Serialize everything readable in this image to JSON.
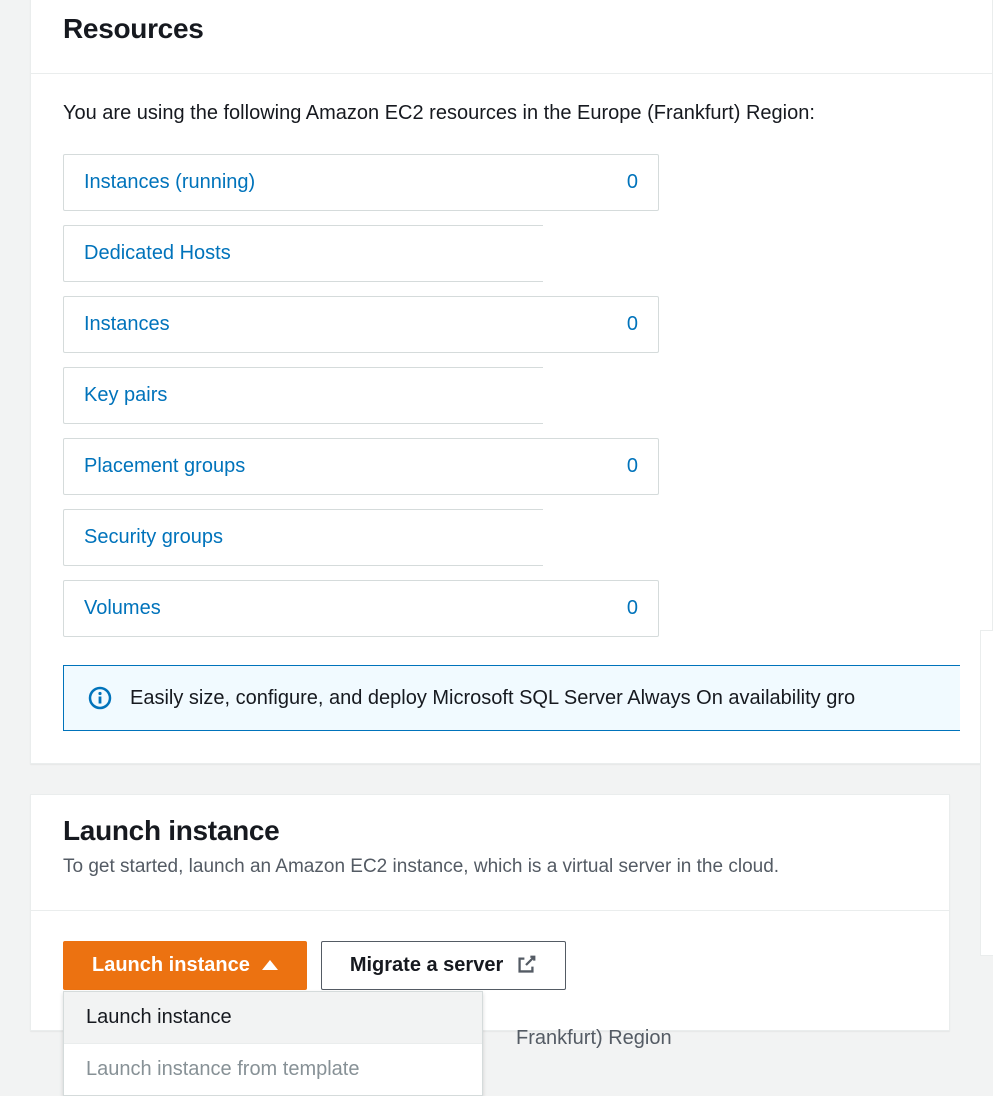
{
  "resources_panel": {
    "title": "Resources",
    "intro": "You are using the following Amazon EC2 resources in the Europe (Frankfurt) Region:",
    "items": [
      {
        "name": "Instances (running)",
        "count": "0",
        "col": 1
      },
      {
        "name": "Dedicated Hosts",
        "count": "",
        "col": 2
      },
      {
        "name": "Instances",
        "count": "0",
        "col": 1
      },
      {
        "name": "Key pairs",
        "count": "",
        "col": 2
      },
      {
        "name": "Placement groups",
        "count": "0",
        "col": 1
      },
      {
        "name": "Security groups",
        "count": "",
        "col": 2
      },
      {
        "name": "Volumes",
        "count": "0",
        "col": 1
      }
    ],
    "banner": "Easily size, configure, and deploy Microsoft SQL Server Always On availability gro"
  },
  "launch_panel": {
    "title": "Launch instance",
    "subtext": "To get started, launch an Amazon EC2 instance, which is a virtual server in the cloud.",
    "primary_button": "Launch instance",
    "secondary_button": "Migrate a server",
    "dropdown": [
      "Launch instance",
      "Launch instance from template"
    ],
    "note_suffix": "Frankfurt) Region"
  }
}
